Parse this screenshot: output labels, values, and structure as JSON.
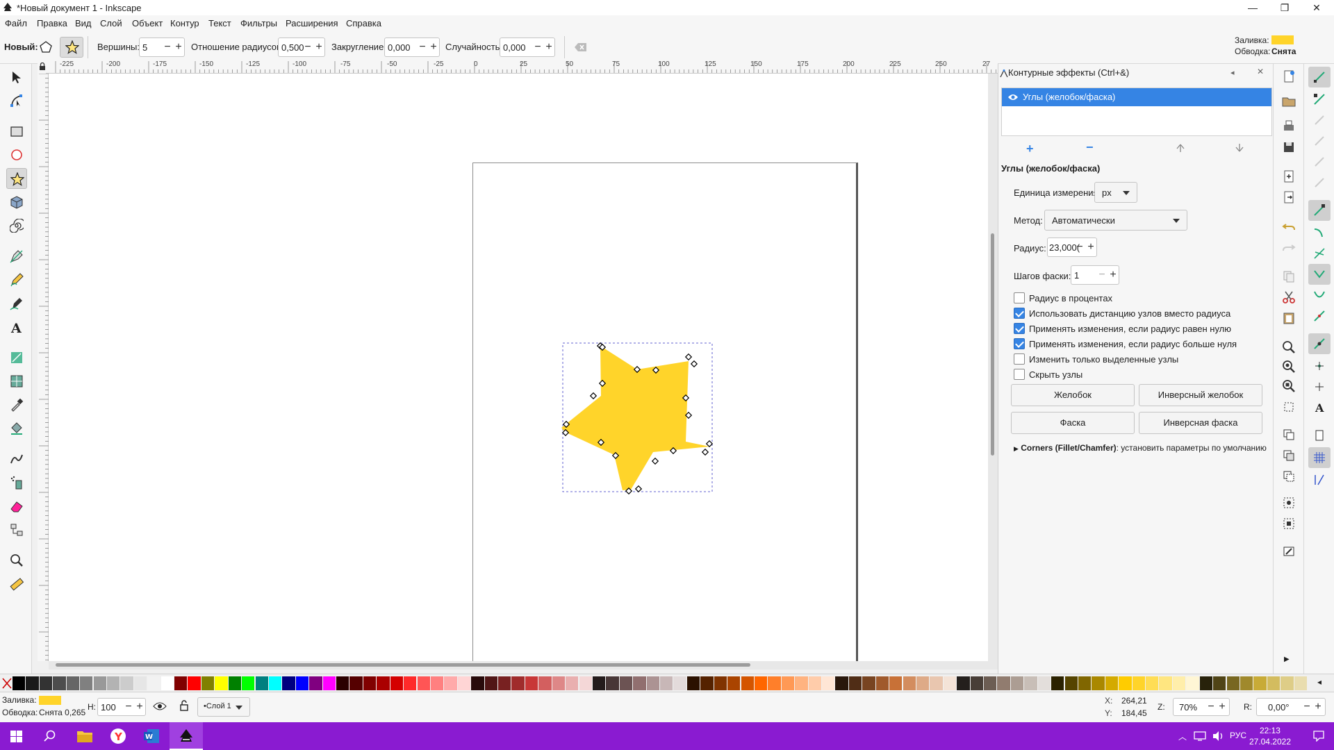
{
  "window": {
    "title": "*Новый документ 1 - Inkscape",
    "minimize": "—",
    "maximize": "❐",
    "close": "✕"
  },
  "menu": [
    "Файл",
    "Правка",
    "Вид",
    "Слой",
    "Объект",
    "Контур",
    "Текст",
    "Фильтры",
    "Расширения",
    "Справка"
  ],
  "tool_controls": {
    "new_label": "Новый:",
    "vertices_label": "Вершины:",
    "vertices_value": "5",
    "ratio_label": "Отношение радиусов:",
    "ratio_value": "0,500",
    "rounding_label": "Закругление:",
    "rounding_value": "0,000",
    "random_label": "Случайность:",
    "random_value": "0,000",
    "fill_label": "Заливка:",
    "stroke_label": "Обводка:",
    "stroke_value": "Снята",
    "fill_color": "#ffd42a"
  },
  "ruler_ticks": [
    "-225",
    "-200",
    "-175",
    "-150",
    "-125",
    "-100",
    "-75",
    "-50",
    "-25",
    "0",
    "25",
    "50",
    "75",
    "100",
    "125",
    "150",
    "175",
    "200",
    "225",
    "250",
    "27"
  ],
  "lpe_dialog": {
    "header": "Контурные эффекты (Ctrl+&)",
    "selected_effect": "Углы (желобок/фаска)",
    "section_title": "Углы (желобок/фаска)",
    "unit_label": "Единица измерения",
    "unit_value": "px",
    "method_label": "Метод:",
    "method_value": "Автоматически",
    "radius_label": "Радиус:",
    "radius_value": "23,000(",
    "steps_label": "Шагов фаски:",
    "steps_value": "1",
    "options": [
      {
        "label": "Радиус в процентах",
        "checked": false
      },
      {
        "label": "Использовать дистанцию узлов вместо радиуса",
        "checked": true
      },
      {
        "label": "Применять изменения, если радиус равен нулю",
        "checked": true
      },
      {
        "label": "Применять изменения, если радиус больше нуля",
        "checked": true
      },
      {
        "label": "Изменить только выделенные узлы",
        "checked": false
      },
      {
        "label": "Скрыть узлы",
        "checked": false
      }
    ],
    "btn_fillet": "Желобок",
    "btn_inverse_fillet": "Инверсный желобок",
    "btn_chamfer": "Фаска",
    "btn_inverse_chamfer": "Инверсная фаска",
    "defaults_bold": "Corners (Fillet/Chamfer)",
    "defaults_rest": ": установить параметры по умолчанию"
  },
  "palette": [
    "#000000",
    "#1a1a1a",
    "#333333",
    "#4d4d4d",
    "#666666",
    "#808080",
    "#999999",
    "#b3b3b3",
    "#cccccc",
    "#e6e6e6",
    "#f2f2f2",
    "#ffffff",
    "#800000",
    "#ff0000",
    "#808000",
    "#ffff00",
    "#008000",
    "#00ff00",
    "#008080",
    "#00ffff",
    "#000080",
    "#0000ff",
    "#800080",
    "#ff00ff",
    "#2b0000",
    "#550000",
    "#800000",
    "#aa0000",
    "#d40000",
    "#ff2a2a",
    "#ff5555",
    "#ff8080",
    "#ffaaaa",
    "#ffd5d5",
    "#280b0b",
    "#501616",
    "#782121",
    "#a02c2c",
    "#c83737",
    "#d35f5f",
    "#de8787",
    "#e9afaf",
    "#f4d7d7",
    "#241c1c",
    "#483737",
    "#6c5353",
    "#916f6f",
    "#ac9393",
    "#c8b7b7",
    "#e3dbdb",
    "#2b1100",
    "#552200",
    "#803300",
    "#aa4400",
    "#d45500",
    "#ff6600",
    "#ff7f2a",
    "#ff9955",
    "#ffb380",
    "#ffccaa",
    "#ffe6d5",
    "#28170b",
    "#502d16",
    "#784421",
    "#a05a2c",
    "#c87137",
    "#d38d5f",
    "#deaa87",
    "#e9c6af",
    "#f4e3d7",
    "#241f1c",
    "#483e37",
    "#6c5d53",
    "#917c6f",
    "#ac9d93",
    "#c8beb7",
    "#e3dedb",
    "#2b2200",
    "#554400",
    "#806600",
    "#aa8800",
    "#d4aa00",
    "#ffcc00",
    "#ffd42a",
    "#ffdd55",
    "#ffe680",
    "#ffeeaa",
    "#fff6d5",
    "#28220b",
    "#504416",
    "#786721",
    "#a0892c",
    "#c8ab37",
    "#d3bc5f",
    "#decd87",
    "#e9ddaf"
  ],
  "status": {
    "fill_label": "Заливка:",
    "stroke_label": "Обводка:",
    "stroke_value": "Снята 0,265",
    "h_label": "H:",
    "h_value": "100",
    "layer": "•Слой 1",
    "x_label": "X:",
    "x_value": "264,21",
    "y_label": "Y:",
    "y_value": "184,45",
    "z_label": "Z:",
    "zoom": "70%",
    "r_label": "R:",
    "rotation": "0,00°"
  },
  "taskbar": {
    "lang": "РУС",
    "time": "22:13",
    "date": "27.04.2022"
  }
}
